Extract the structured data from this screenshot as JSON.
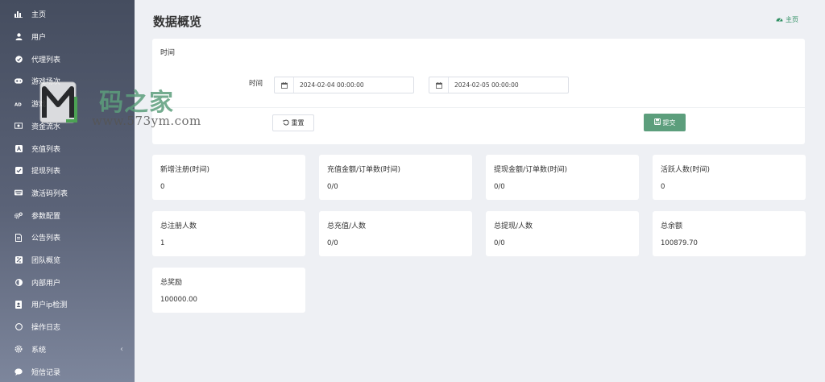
{
  "sidebar": {
    "items": [
      {
        "label": "主页",
        "icon": "bar-chart-icon"
      },
      {
        "label": "用户",
        "icon": "user-icon"
      },
      {
        "label": "代理列表",
        "icon": "agent-icon"
      },
      {
        "label": "游戏场次",
        "icon": "gamepad-icon"
      },
      {
        "label": "游戏",
        "icon": "ad-icon"
      },
      {
        "label": "资金流水",
        "icon": "money-icon"
      },
      {
        "label": "充值列表",
        "icon": "recharge-icon"
      },
      {
        "label": "提现列表",
        "icon": "check-square-icon"
      },
      {
        "label": "激活码列表",
        "icon": "keyboard-icon"
      },
      {
        "label": "参数配置",
        "icon": "cogs-icon"
      },
      {
        "label": "公告列表",
        "icon": "file-icon"
      },
      {
        "label": "团队概览",
        "icon": "team-icon"
      },
      {
        "label": "内部用户",
        "icon": "adjust-icon"
      },
      {
        "label": "用户ip检测",
        "icon": "address-book-icon"
      },
      {
        "label": "操作日志",
        "icon": "circle-icon"
      },
      {
        "label": "系统",
        "icon": "gear-icon"
      },
      {
        "label": "短信记录",
        "icon": "comment-icon"
      }
    ]
  },
  "header": {
    "title": "数据概览",
    "breadcrumb": "主页"
  },
  "filter": {
    "title": "时间",
    "time_label": "时间",
    "start_date": "2024-02-04 00:00:00",
    "end_date": "2024-02-05 00:00:00",
    "reset_label": "重置",
    "submit_label": "提交"
  },
  "stats": [
    {
      "title": "新增注册(时间)",
      "value": "0"
    },
    {
      "title": "充值金额/订单数(时间)",
      "value": "0/0"
    },
    {
      "title": "提现金额/订单数(时间)",
      "value": "0/0"
    },
    {
      "title": "活跃人数(时间)",
      "value": "0"
    },
    {
      "title": "总注册人数",
      "value": "1"
    },
    {
      "title": "总充值/人数",
      "value": "0/0"
    },
    {
      "title": "总提现/人数",
      "value": "0/0"
    },
    {
      "title": "总余额",
      "value": "100879.70"
    },
    {
      "title": "总奖励",
      "value": "100000.00"
    }
  ],
  "watermark": {
    "text": "码之家",
    "url": "www.573ym.com"
  },
  "colors": {
    "accent": "#5c9e7c",
    "breadcrumb": "#2f8f62",
    "sidebar_top": "#454d5f",
    "sidebar_bottom": "#7d869c",
    "background": "#eef0f4"
  }
}
